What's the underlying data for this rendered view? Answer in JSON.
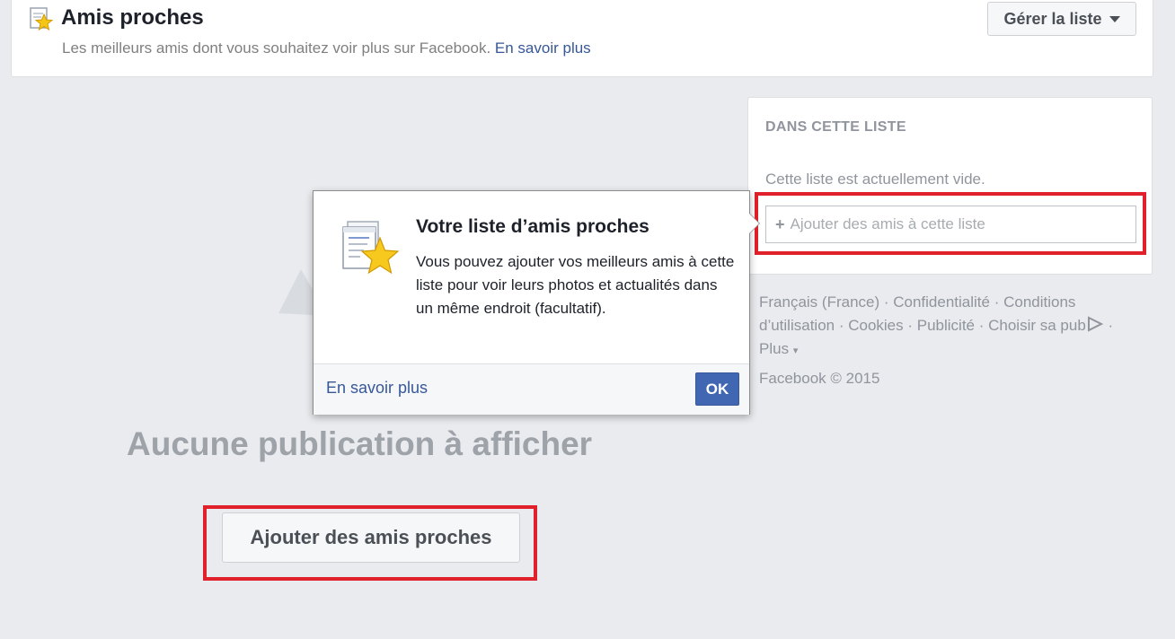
{
  "header": {
    "title": "Amis proches",
    "subtitle": "Les meilleurs amis dont vous souhaitez voir plus sur Facebook.",
    "learn_more": "En savoir plus",
    "manage_button": "Gérer la liste",
    "icon": "star-list-icon"
  },
  "sidebar": {
    "heading": "DANS CETTE LISTE",
    "empty_text": "Cette liste est actuellement vide.",
    "add_placeholder": "Ajouter des amis à cette liste"
  },
  "footer": {
    "links": [
      "Français (France)",
      "Confidentialité",
      "Conditions d’utilisation",
      "Cookies",
      "Publicité",
      "Choisir sa pub",
      "Plus"
    ],
    "copyright": "Facebook © 2015"
  },
  "main": {
    "empty_title": "Aucune publication à afficher",
    "add_button": "Ajouter des amis proches"
  },
  "popover": {
    "title": "Votre liste d’amis proches",
    "body": "Vous pouvez ajouter vos meilleurs amis à cette liste pour voir leurs photos et actualités dans un même endroit (facultatif).",
    "learn_more": "En savoir plus",
    "ok": "OK"
  },
  "colors": {
    "link": "#365899",
    "primary": "#4267b2",
    "highlight": "#e0202a",
    "background": "#e9ebee"
  }
}
